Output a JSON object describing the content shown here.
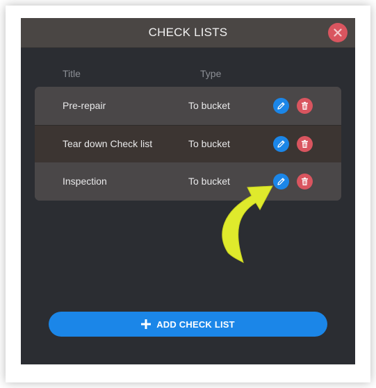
{
  "dialog": {
    "title": "CHECK LISTS"
  },
  "columns": {
    "title": "Title",
    "type": "Type"
  },
  "rows": [
    {
      "title": "Pre-repair",
      "type": "To bucket"
    },
    {
      "title": "Tear down Check list",
      "type": "To bucket"
    },
    {
      "title": "Inspection",
      "type": "To bucket"
    }
  ],
  "actions": {
    "add_label": "ADD CHECK LIST"
  },
  "icons": {
    "close": "close-icon",
    "edit": "pencil-icon",
    "delete": "trash-icon",
    "add": "plus-icon",
    "annotation": "arrow-icon"
  },
  "colors": {
    "background": "#2b2d32",
    "header": "#4a4644",
    "accent": "#1b86e8",
    "danger": "#d9555f",
    "highlight_arrow": "#dfea2c"
  }
}
